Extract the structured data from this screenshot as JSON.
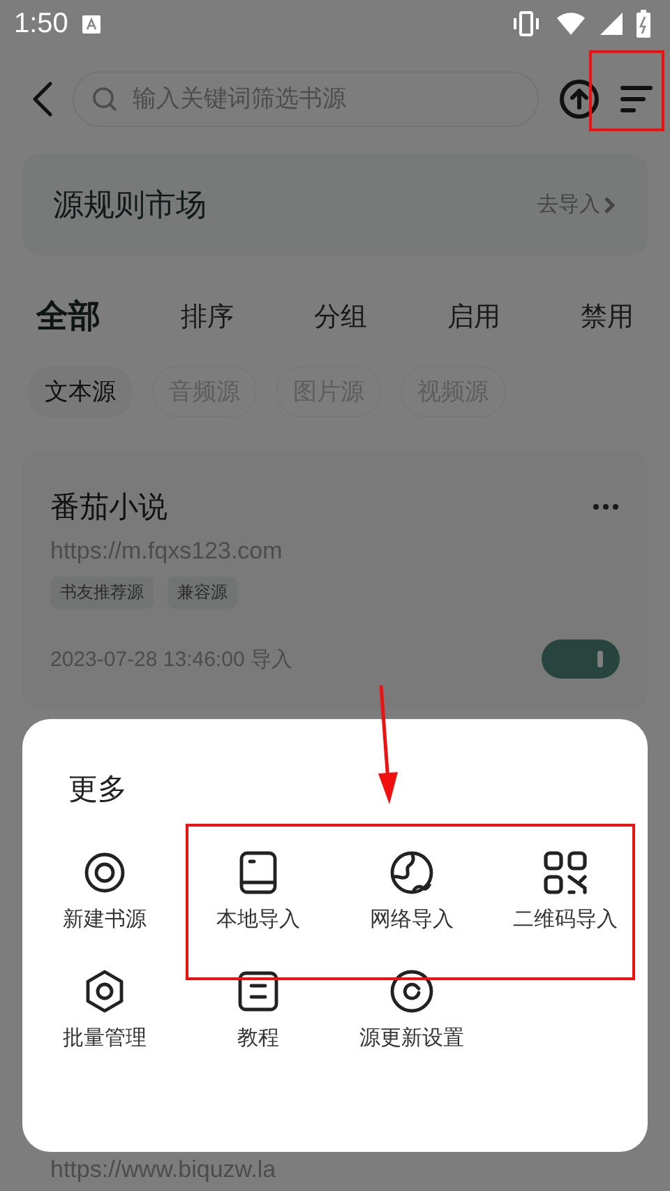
{
  "status_bar": {
    "time": "1:50"
  },
  "toolbar": {
    "search": {
      "placeholder": "输入关键词筛选书源"
    }
  },
  "market": {
    "title": "源规则市场",
    "action": "去导入"
  },
  "tabs": [
    {
      "label": "全部",
      "selected": true
    },
    {
      "label": "排序",
      "selected": false
    },
    {
      "label": "分组",
      "selected": false
    },
    {
      "label": "启用",
      "selected": false
    },
    {
      "label": "禁用",
      "selected": false
    }
  ],
  "chips": [
    {
      "label": "文本源",
      "selected": true
    },
    {
      "label": "音频源",
      "selected": false
    },
    {
      "label": "图片源",
      "selected": false
    },
    {
      "label": "视频源",
      "selected": false
    }
  ],
  "sources": [
    {
      "name": "番茄小说",
      "url": "https://m.fqxs123.com",
      "tags": [
        "书友推荐源",
        "兼容源"
      ],
      "imported": "2023-07-28 13:46:00 导入",
      "on": true
    }
  ],
  "next_source_url": "https://www.biquzw.la",
  "sheet": {
    "title": "更多",
    "items": [
      {
        "label": "新建书源",
        "kind": "target"
      },
      {
        "label": "本地导入",
        "kind": "book"
      },
      {
        "label": "网络导入",
        "kind": "globe"
      },
      {
        "label": "二维码导入",
        "kind": "qr"
      },
      {
        "label": "批量管理",
        "kind": "hexagon"
      },
      {
        "label": "教程",
        "kind": "doc"
      },
      {
        "label": "源更新设置",
        "kind": "refresh"
      }
    ]
  }
}
